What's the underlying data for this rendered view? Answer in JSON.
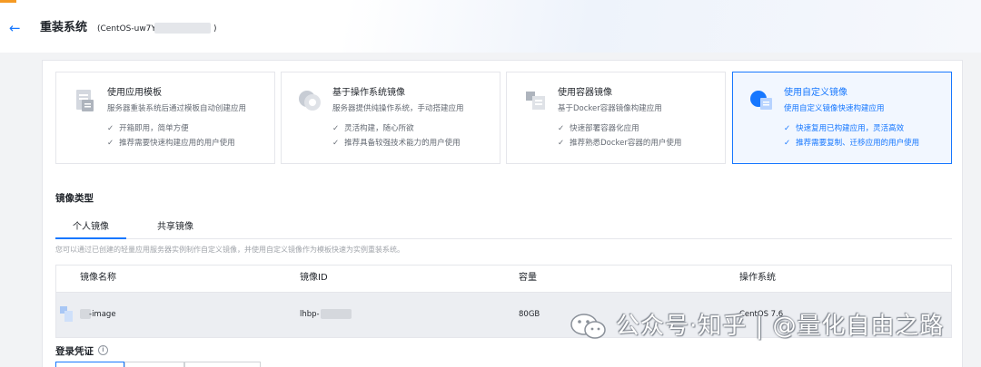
{
  "header": {
    "title": "重装系统",
    "subtitle": "(CentOS-uw7Y",
    "subtitle_end": ")"
  },
  "cards": [
    {
      "title": "使用应用模板",
      "desc": "服务器重装系统后通过模板自动创建应用",
      "features": [
        "开箱即用，简单方便",
        "推荐需要快速构建应用的用户使用"
      ],
      "icon": "app-template-icon"
    },
    {
      "title": "基于操作系统镜像",
      "desc": "服务器提供纯操作系统，手动搭建应用",
      "features": [
        "灵活构建，随心所欲",
        "推荐具备较强技术能力的用户使用"
      ],
      "icon": "os-image-icon"
    },
    {
      "title": "使用容器镜像",
      "desc": "基于Docker容器镜像构建应用",
      "features": [
        "快速部署容器化应用",
        "推荐熟悉Docker容器的用户使用"
      ],
      "icon": "container-image-icon"
    },
    {
      "title": "使用自定义镜像",
      "desc": "使用自定义镜像快速构建应用",
      "features": [
        "快速复用已构建应用，灵活高效",
        "推荐需要复制、迁移应用的用户使用"
      ],
      "icon": "custom-image-icon"
    }
  ],
  "check": "✓",
  "image_type": {
    "label": "镜像类型",
    "tabs": [
      "个人镜像",
      "共享镜像"
    ],
    "hint": "您可以通过已创建的轻量应用服务器实例制作自定义镜像，并使用自定义镜像作为模板快速为实例重装系统。"
  },
  "table": {
    "headers": [
      "镜像名称",
      "镜像ID",
      "容量",
      "操作系统"
    ],
    "row": {
      "name": "-image",
      "id": "lhbp-",
      "size": "80GB",
      "os": "CentOS 7.6"
    }
  },
  "login": {
    "label": "登录凭证",
    "info_icon": "i"
  },
  "watermark": "公众号·知乎 | @量化自由之路",
  "colors": {
    "accent": "#1677ff",
    "brand_orange": "#f59a23"
  }
}
